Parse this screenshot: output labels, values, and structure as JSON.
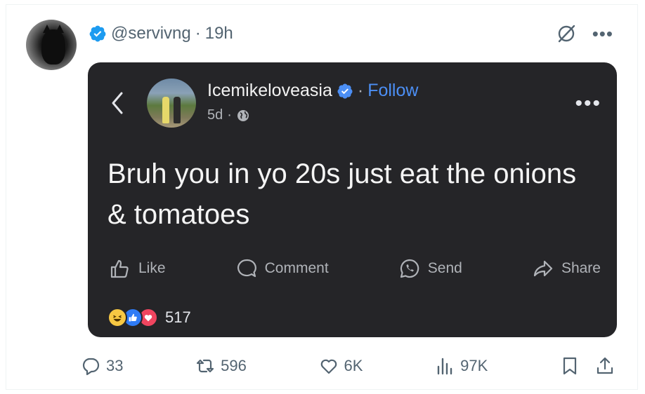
{
  "tweet": {
    "handle": "@servivng",
    "separator": "·",
    "time": "19h"
  },
  "embedded_post": {
    "name": "Icemikeloveasia",
    "separator": "·",
    "follow_label": "Follow",
    "age": "5d",
    "age_separator": "·",
    "text": "Bruh you in yo 20s just eat the onions & tomatoes",
    "actions": {
      "like": "Like",
      "comment": "Comment",
      "send": "Send",
      "share": "Share"
    },
    "reaction_count": "517"
  },
  "metrics": {
    "replies": "33",
    "reposts": "596",
    "likes": "6K",
    "views": "97K"
  },
  "colors": {
    "verified_blue": "#1d9bf0",
    "card_bg": "#252528",
    "follow_blue": "#4c8ff5",
    "metric_gray": "#536471"
  }
}
